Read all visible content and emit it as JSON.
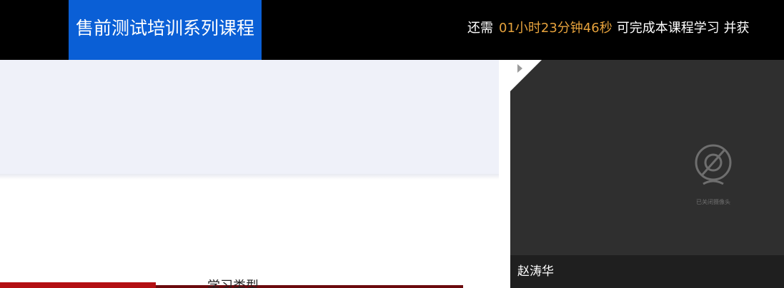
{
  "header": {
    "course_title": "售前测试培训系列课程",
    "timer_prefix": "还需",
    "timer_time": "01小时23分钟46秒",
    "timer_suffix": "可完成本课程学习 并获"
  },
  "slide": {
    "heading": "学习类型"
  },
  "video": {
    "camera_status": "已关闭摄像头",
    "presenter_name": "赵涛华"
  },
  "colors": {
    "topbar": "#000000",
    "title_bg": "#0a5fd6",
    "timer_highlight": "#e6a23c",
    "video_bg": "#2f2f2f",
    "accent_red": "#b30f13"
  }
}
